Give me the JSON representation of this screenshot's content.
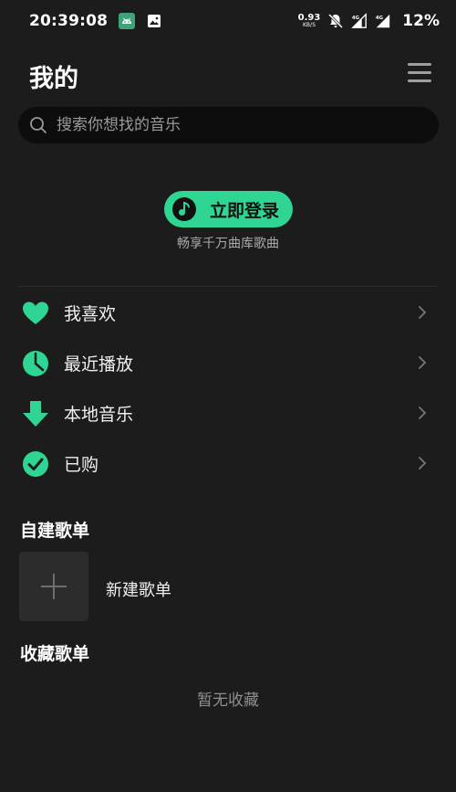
{
  "status_bar": {
    "time": "20:39:08",
    "net_speed_value": "0.93",
    "net_speed_unit": "KB/S",
    "battery": "12%",
    "left_icons": [
      "android-icon",
      "image-icon"
    ],
    "right_icons": [
      "mute-icon",
      "signal-4g-icon",
      "signal-4g-icon"
    ]
  },
  "header": {
    "title": "我的"
  },
  "search": {
    "placeholder": "搜索你想找的音乐"
  },
  "login": {
    "button_label": "立即登录",
    "subtitle": "畅享千万曲库歌曲"
  },
  "menu": {
    "items": [
      {
        "label": "我喜欢",
        "icon": "heart-icon"
      },
      {
        "label": "最近播放",
        "icon": "clock-icon"
      },
      {
        "label": "本地音乐",
        "icon": "download-icon"
      },
      {
        "label": "已购",
        "icon": "check-circle-icon"
      }
    ]
  },
  "my_playlists": {
    "title": "自建歌单",
    "new_label": "新建歌单"
  },
  "collected_playlists": {
    "title": "收藏歌单",
    "empty_text": "暂无收藏"
  },
  "colors": {
    "accent": "#2fd592",
    "background": "#1c1c1c",
    "search_bg": "#0d0d0d"
  }
}
